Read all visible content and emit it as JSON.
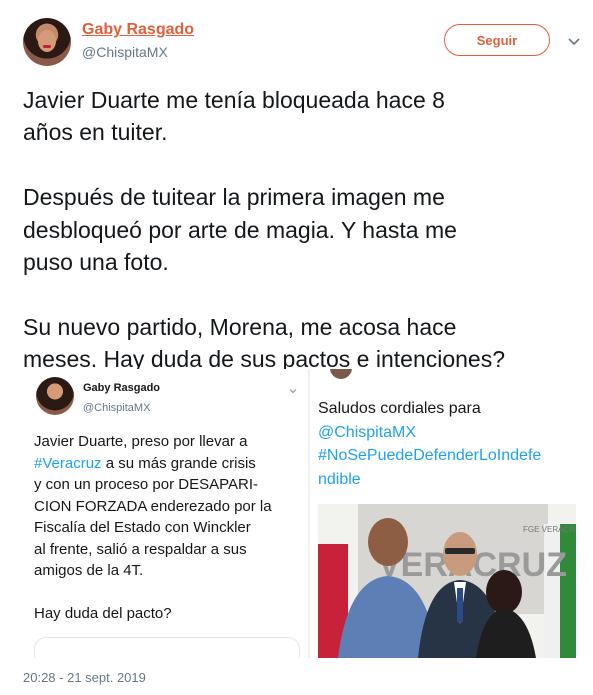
{
  "user": {
    "name": "Gaby Rasgado",
    "handle": "@ChispitaMX",
    "follow_label": "Seguir"
  },
  "tweet": {
    "lines": [
      "Javier Duarte me tenía bloqueada hace 8",
      "años en tuiter.",
      "",
      "Después de tuitear la primera imagen me",
      "desbloqueó por arte de magia. Y hasta me",
      "puso una foto.",
      "",
      "Su nuevo partido, Morena, me acosa hace",
      "meses. Hay duda de sus pactos e intenciones?"
    ]
  },
  "embedded_left": {
    "name": "Gaby Rasgado",
    "handle": "@ChispitaMX",
    "line1": "Javier Duarte, preso por llevar a",
    "line2_link": "#Veracruz",
    "line2_rest": " a su más grande crisis",
    "line3": "y con un proceso por DESAPARI-",
    "line4": "CION FORZADA enderezado por la",
    "line5": "Fiscalía del Estado con Winckler",
    "line6": "al frente, salió a respaldar a sus",
    "line7": "amigos de la 4T.",
    "line8": "Hay duda del pacto?"
  },
  "embedded_right": {
    "line1": "Saludos cordiales para",
    "link1": "@ChispitaMX",
    "link2": "#NoSePuedeDefenderLoIndefe",
    "link3": "ndible",
    "photo_sign": "VERACRUZ",
    "photo_badge": "FGE VERACR"
  },
  "timestamp": "20:28 - 21 sept. 2019",
  "colors": {
    "accent": "#e0603c",
    "link": "#1da1f2",
    "muted": "#657786"
  }
}
